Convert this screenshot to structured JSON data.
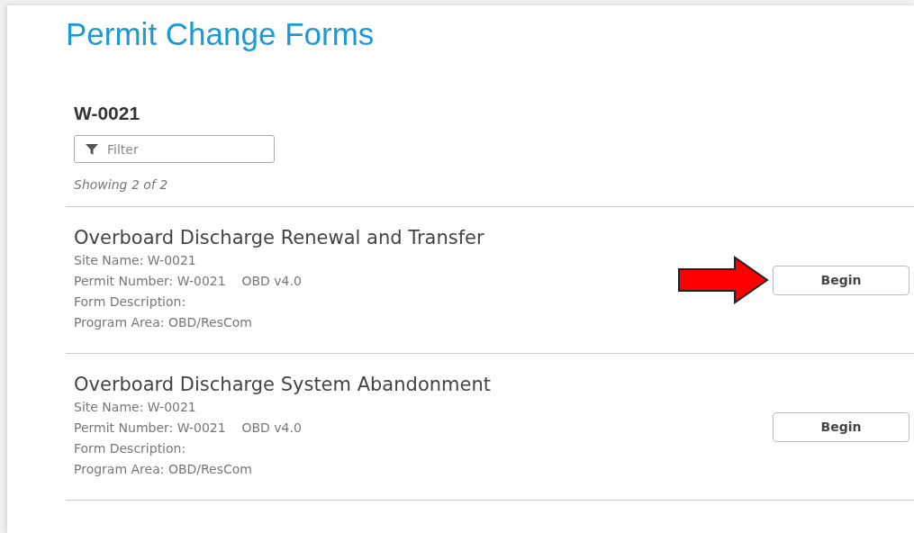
{
  "title": "Permit Change Forms",
  "site": {
    "heading": "W-0021",
    "filter": {
      "placeholder": "Filter"
    },
    "count": "Showing 2 of 2"
  },
  "forms": [
    {
      "name": "Overboard Discharge Renewal and Transfer",
      "details": [
        "Site Name: W-0021",
        "Permit Number: W-0021    OBD v4.0",
        "Form Description:",
        "Program Area: OBD/ResCom"
      ],
      "button": "Begin",
      "arrow": true
    },
    {
      "name": "Overboard Discharge System Abandonment",
      "details": [
        "Site Name: W-0021",
        "Permit Number: W-0021    OBD v4.0",
        "Form Description:",
        "Program Area: OBD/ResCom"
      ],
      "button": "Begin",
      "arrow": false
    }
  ]
}
